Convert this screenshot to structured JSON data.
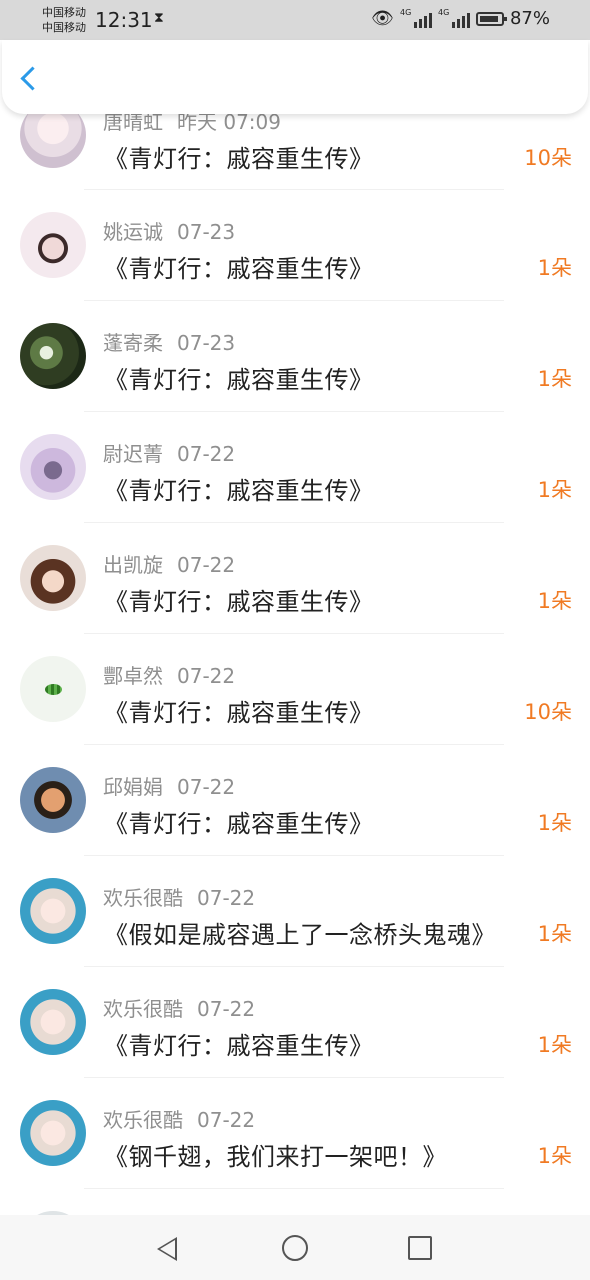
{
  "status_bar": {
    "carrier_1": "中国移动",
    "carrier_2": "中国移动",
    "time": "12:31",
    "signal_tag_1": "4G",
    "signal_tag_2": "4G",
    "battery_percent": "87%"
  },
  "header": {
    "back_icon": "chevron-left-icon",
    "accent": "#2b9ae8"
  },
  "list": {
    "amount_color": "#f07a23",
    "items": [
      {
        "name": "唐晴虹",
        "date": "昨天 07:09",
        "title": "《青灯行：戚容重生传》",
        "amount": "10朵"
      },
      {
        "name": "姚运诚",
        "date": "07-23",
        "title": "《青灯行：戚容重生传》",
        "amount": "1朵"
      },
      {
        "name": "蓬寄柔",
        "date": "07-23",
        "title": "《青灯行：戚容重生传》",
        "amount": "1朵"
      },
      {
        "name": "尉迟菁",
        "date": "07-22",
        "title": "《青灯行：戚容重生传》",
        "amount": "1朵"
      },
      {
        "name": "出凯旋",
        "date": "07-22",
        "title": "《青灯行：戚容重生传》",
        "amount": "1朵"
      },
      {
        "name": "酆卓然",
        "date": "07-22",
        "title": "《青灯行：戚容重生传》",
        "amount": "10朵"
      },
      {
        "name": "邱娟娟",
        "date": "07-22",
        "title": "《青灯行：戚容重生传》",
        "amount": "1朵"
      },
      {
        "name": "欢乐很酷",
        "date": "07-22",
        "title": "《假如是戚容遇上了一念桥头鬼魂》",
        "amount": "1朵"
      },
      {
        "name": "欢乐很酷",
        "date": "07-22",
        "title": "《青灯行：戚容重生传》",
        "amount": "1朵"
      },
      {
        "name": "欢乐很酷",
        "date": "07-22",
        "title": "《钢千翅，我们来打一架吧！》",
        "amount": "1朵"
      }
    ]
  },
  "navbar": {
    "back": "triangle-back-icon",
    "home": "circle-home-icon",
    "recent": "square-recents-icon"
  }
}
